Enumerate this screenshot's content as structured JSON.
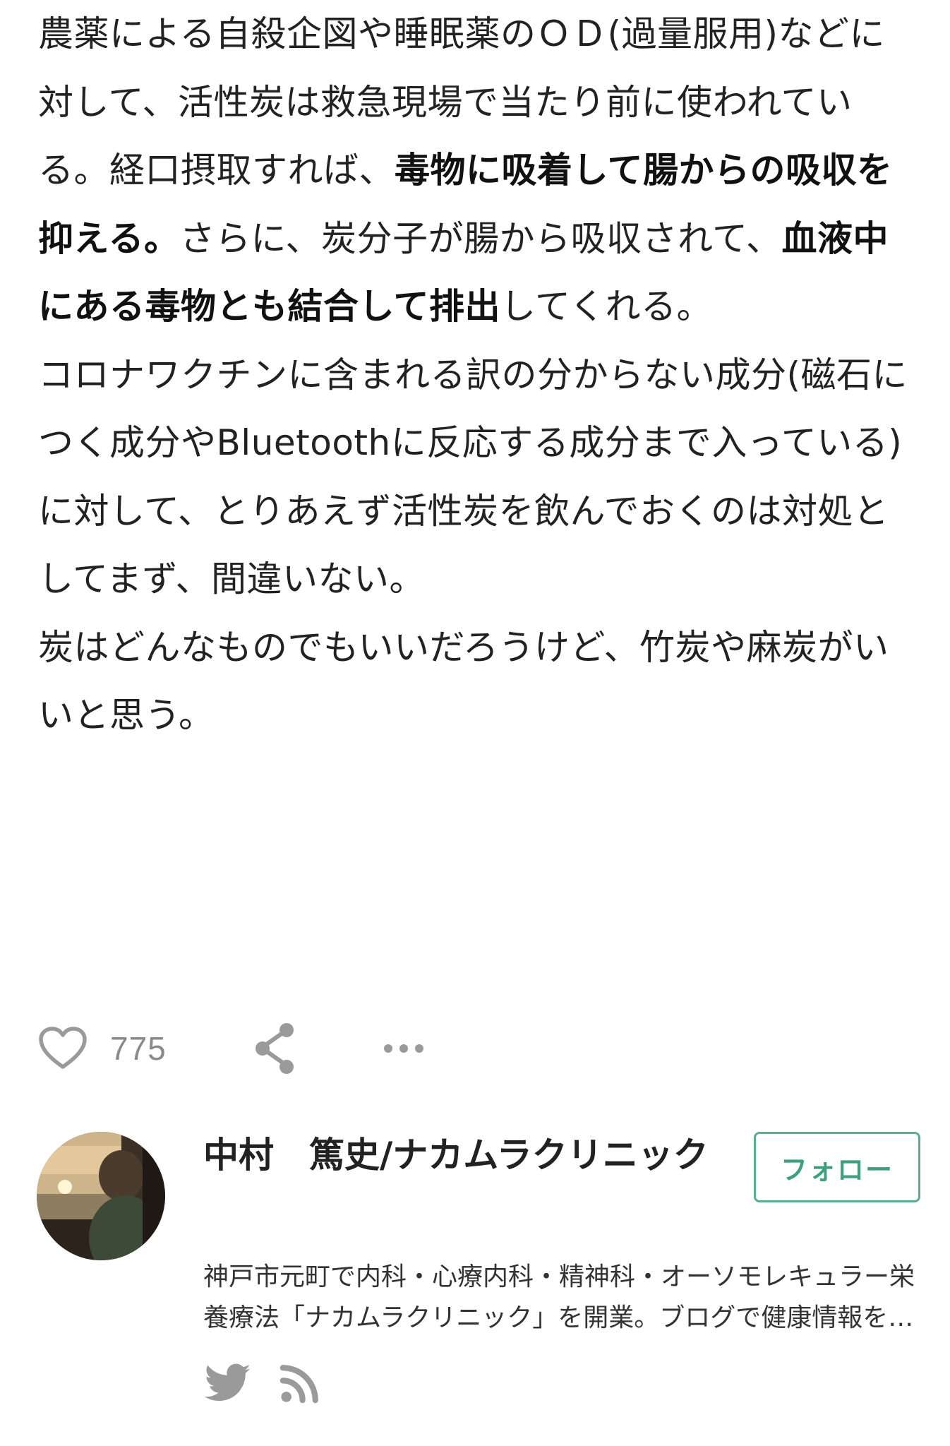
{
  "article": {
    "p1": {
      "t1": "農薬による自殺企図や睡眠薬のＯＤ(過量服用)などに対して、活性炭は救急現場で当たり前に使われている。経口摂取すれば、",
      "b1": "毒物に吸着して腸からの吸収を抑える。",
      "t2": "さらに、炭分子が腸から吸収されて、",
      "b2": "血液中にある毒物とも結合して排出",
      "t3": "してくれる。"
    },
    "p2": "コロナワクチンに含まれる訳の分からない成分(磁石につく成分やBluetoothに反応する成分まで入っている)に対して、とりあえず活性炭を飲んでおくのは対処としてまず、間違いない。",
    "p3": "炭はどんなものでもいいだろうけど、竹炭や麻炭がいいと思う。"
  },
  "actions": {
    "like_count": "775",
    "icons": [
      "heart-icon",
      "share-icon",
      "more-icon"
    ]
  },
  "author": {
    "name": "中村　篤史/ナカムラクリニック",
    "follow_label": "フォロー",
    "bio": "神戸市元町で内科・心療内科・精神科・オーソモレキュラー栄養療法「ナカムラクリニック」を開業。ブログで健康情報を発信しています。",
    "social_icons": [
      "twitter-icon",
      "rss-icon"
    ]
  },
  "colors": {
    "accent": "#3ea07c",
    "accent_border": "#5aae8f",
    "text": "#222222",
    "muted": "#8a8a8a"
  }
}
